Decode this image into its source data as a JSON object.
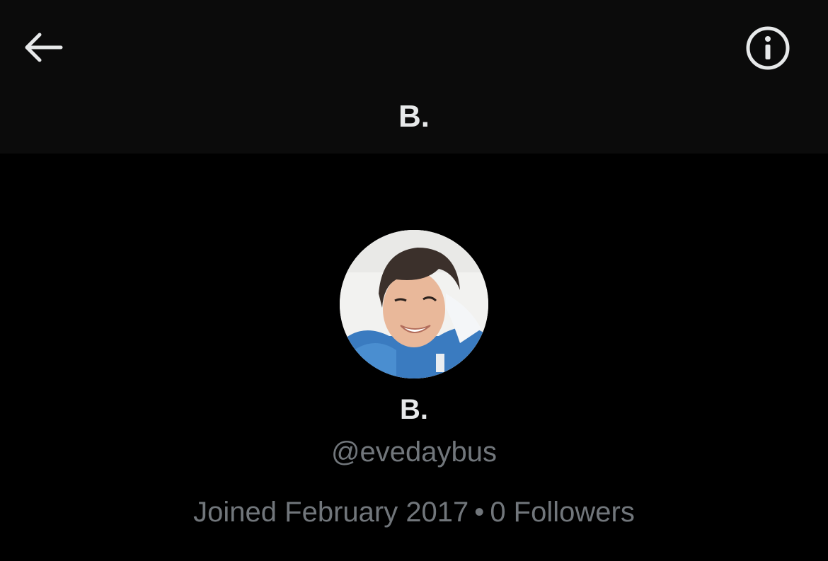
{
  "header": {
    "title": "B.",
    "back_icon": "arrow-left-icon",
    "info_icon": "info-circle-icon"
  },
  "profile": {
    "display_name": "B.",
    "handle": "@evedaybus",
    "joined": "Joined February 2017",
    "separator": "•",
    "followers": "0 Followers"
  },
  "colors": {
    "background": "#000000",
    "header_bg": "#0b0b0b",
    "primary_text": "#e7e9ea",
    "secondary_text": "#71767b"
  }
}
